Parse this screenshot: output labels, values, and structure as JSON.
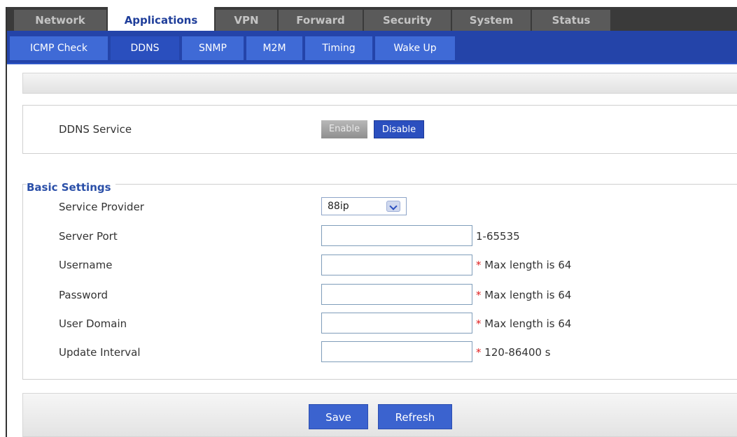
{
  "top_tabs": [
    {
      "label": "Network",
      "active": false
    },
    {
      "label": "Applications",
      "active": true
    },
    {
      "label": "VPN",
      "active": false
    },
    {
      "label": "Forward",
      "active": false
    },
    {
      "label": "Security",
      "active": false
    },
    {
      "label": "System",
      "active": false
    },
    {
      "label": "Status",
      "active": false
    }
  ],
  "sub_tabs": [
    {
      "label": "ICMP Check",
      "active": false
    },
    {
      "label": "DDNS",
      "active": true
    },
    {
      "label": "SNMP",
      "active": false
    },
    {
      "label": "M2M",
      "active": false
    },
    {
      "label": "Timing",
      "active": false
    },
    {
      "label": "Wake Up",
      "active": false
    }
  ],
  "service": {
    "label": "DDNS Service",
    "enable_label": "Enable",
    "disable_label": "Disable",
    "selected": "Disable"
  },
  "basic": {
    "legend": "Basic Settings",
    "service_provider": {
      "label": "Service Provider",
      "value": "88ip"
    },
    "server_port": {
      "label": "Server Port",
      "value": "",
      "note": "1-65535"
    },
    "username": {
      "label": "Username",
      "value": "",
      "required": "*",
      "note": "Max length is 64"
    },
    "password": {
      "label": "Password",
      "value": "",
      "required": "*",
      "note": "Max length is 64"
    },
    "user_domain": {
      "label": "User Domain",
      "value": "",
      "required": "*",
      "note": "Max length is 64"
    },
    "update_interval": {
      "label": "Update Interval",
      "value": "",
      "required": "*",
      "note": "120-86400 s"
    }
  },
  "actions": {
    "save_label": "Save",
    "refresh_label": "Refresh"
  },
  "colors": {
    "header_dark": "#3a3a3a",
    "accent_blue": "#2444a9",
    "button_blue": "#3b63cf",
    "required_red": "#e02020",
    "legend_blue": "#2a4fa8"
  }
}
